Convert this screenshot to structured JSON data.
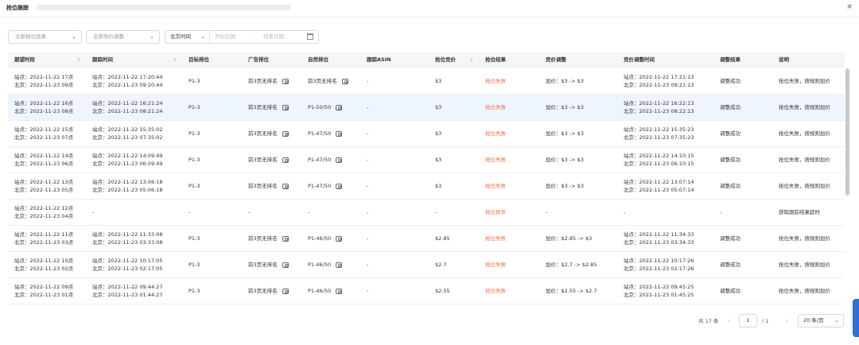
{
  "header": {
    "title": "抢位跟踪",
    "close_icon": "close-icon"
  },
  "filters": {
    "result": "全部抢位结果",
    "price_adjust": "全部竞价调整",
    "timezone": "北京时间",
    "start_placeholder": "开始日期",
    "separator": "-",
    "end_placeholder": "结束日期"
  },
  "columns": [
    {
      "label": "期望时段",
      "sortable": true
    },
    {
      "label": "跟踪时间",
      "sortable": true
    },
    {
      "label": "目标排位",
      "sortable": false
    },
    {
      "label": "广告排位",
      "sortable": false
    },
    {
      "label": "自然排位",
      "sortable": false
    },
    {
      "label": "跟踪ASIN",
      "sortable": false
    },
    {
      "label": "抢位竞价",
      "sortable": true
    },
    {
      "label": "抢位结果",
      "sortable": false
    },
    {
      "label": "竞价调整",
      "sortable": false
    },
    {
      "label": "竞价调整时间",
      "sortable": false
    },
    {
      "label": "调整结果",
      "sortable": false
    },
    {
      "label": "说明",
      "sortable": false
    }
  ],
  "rows": [
    {
      "period": [
        "站点：2022-11-22 17点",
        "北京：2022-11-23 09点"
      ],
      "track": [
        "站点：2022-11-22 17:20:44",
        "北京：2022-11-23 09:20:44"
      ],
      "target": "P1-3",
      "ad": "前3页无排名",
      "natural": "前3页无排名",
      "asin": "-",
      "bid": "$3",
      "result": "抢位失败",
      "adjust": "加价：$3 -> $3",
      "adjust_time": [
        "站点：2022-11-22 17:21:13",
        "北京：2022-11-23 09:21:13"
      ],
      "adjust_result": "调整成功",
      "note": "抢位失败，按规则加价"
    },
    {
      "period": [
        "站点：2022-11-22 16点",
        "北京：2022-11-23 08点"
      ],
      "track": [
        "站点：2022-11-22 16:21:24",
        "北京：2022-11-23 08:21:24"
      ],
      "target": "P1-3",
      "ad": "前3页无排名",
      "natural": "P1-50/50",
      "asin": "-",
      "bid": "$3",
      "result": "抢位失败",
      "adjust": "加价：$3 -> $3",
      "adjust_time": [
        "站点：2022-11-22 16:22:13",
        "北京：2022-11-23 08:22:13"
      ],
      "adjust_result": "调整成功",
      "note": "抢位失败，按规则加价"
    },
    {
      "period": [
        "站点：2022-11-22 15点",
        "北京：2022-11-23 07点"
      ],
      "track": [
        "站点：2022-11-22 15:35:02",
        "北京：2022-11-23 07:35:02"
      ],
      "target": "P1-3",
      "ad": "前3页无排名",
      "natural": "P1-47/50",
      "asin": "-",
      "bid": "$3",
      "result": "抢位失败",
      "adjust": "加价：$3 -> $3",
      "adjust_time": [
        "站点：2022-11-22 15:35:23",
        "北京：2022-11-23 07:35:23"
      ],
      "adjust_result": "调整成功",
      "note": "抢位失败，按规则加价"
    },
    {
      "period": [
        "站点：2022-11-22 14点",
        "北京：2022-11-23 06点"
      ],
      "track": [
        "站点：2022-11-22 14:09:49",
        "北京：2022-11-23 06:09:49"
      ],
      "target": "P1-3",
      "ad": "前3页无排名",
      "natural": "P1-47/50",
      "asin": "-",
      "bid": "$3",
      "result": "抢位失败",
      "adjust": "加价：$3 -> $3",
      "adjust_time": [
        "站点：2022-11-22 14:10:15",
        "北京：2022-11-23 06:10:15"
      ],
      "adjust_result": "调整成功",
      "note": "抢位失败，按规则加价"
    },
    {
      "period": [
        "站点：2022-11-22 13点",
        "北京：2022-11-23 05点"
      ],
      "track": [
        "站点：2022-11-22 13:06:18",
        "北京：2022-11-23 05:06:18"
      ],
      "target": "P1-3",
      "ad": "前3页无排名",
      "natural": "P1-47/50",
      "asin": "-",
      "bid": "$3",
      "result": "抢位失败",
      "adjust": "加价：$3 -> $3",
      "adjust_time": [
        "站点：2022-11-22 13:07:14",
        "北京：2022-11-23 05:07:14"
      ],
      "adjust_result": "调整成功",
      "note": "抢位失败，按规则加价"
    },
    {
      "period": [
        "站点：2022-11-22 12点",
        "北京：2022-11-23 04点"
      ],
      "track": [
        "-",
        ""
      ],
      "target": "-",
      "ad": "-",
      "natural": "-",
      "asin": "-",
      "bid": "-",
      "result": "抢位异常",
      "adjust": "-",
      "adjust_time": [
        "-",
        ""
      ],
      "adjust_result": "-",
      "note": "获取跟踪结果超时"
    },
    {
      "period": [
        "站点：2022-11-22 11点",
        "北京：2022-11-23 03点"
      ],
      "track": [
        "站点：2022-11-22 11:33:08",
        "北京：2022-11-23 03:33:08"
      ],
      "target": "P1-3",
      "ad": "前3页无排名",
      "natural": "P1-46/50",
      "asin": "-",
      "bid": "$2.85",
      "result": "抢位失败",
      "adjust": "加价：$2.85 -> $3",
      "adjust_time": [
        "站点：2022-11-22 11:34:33",
        "北京：2022-11-23 03:34:33"
      ],
      "adjust_result": "调整成功",
      "note": "抢位失败，按规则加价"
    },
    {
      "period": [
        "站点：2022-11-22 10点",
        "北京：2022-11-23 02点"
      ],
      "track": [
        "站点：2022-11-22 10:17:05",
        "北京：2022-11-23 02:17:05"
      ],
      "target": "P1-3",
      "ad": "前3页无排名",
      "natural": "P1-46/50",
      "asin": "-",
      "bid": "$2.7",
      "result": "抢位失败",
      "adjust": "加价：$2.7 -> $2.85",
      "adjust_time": [
        "站点：2022-11-22 10:17:26",
        "北京：2022-11-23 02:17:26"
      ],
      "adjust_result": "调整成功",
      "note": "抢位失败，按规则加价"
    },
    {
      "period": [
        "站点：2022-11-22 09点",
        "北京：2022-11-23 01点"
      ],
      "track": [
        "站点：2022-11-22 09:44:27",
        "北京：2022-11-23 01:44:27"
      ],
      "target": "P1-3",
      "ad": "前3页无排名",
      "natural": "P1-46/50",
      "asin": "-",
      "bid": "$2.55",
      "result": "抢位失败",
      "adjust": "加价：$2.55 -> $2.7",
      "adjust_time": [
        "站点：2022-11-22 09:45:25",
        "北京：2022-11-23 01:45:25"
      ],
      "adjust_result": "调整成功",
      "note": "抢位失败，按规则加价"
    }
  ],
  "pagination": {
    "total": "共 17 条",
    "prev": "‹",
    "page": "1",
    "pages": "/ 1",
    "next": "›",
    "page_size": "20 条/页"
  }
}
